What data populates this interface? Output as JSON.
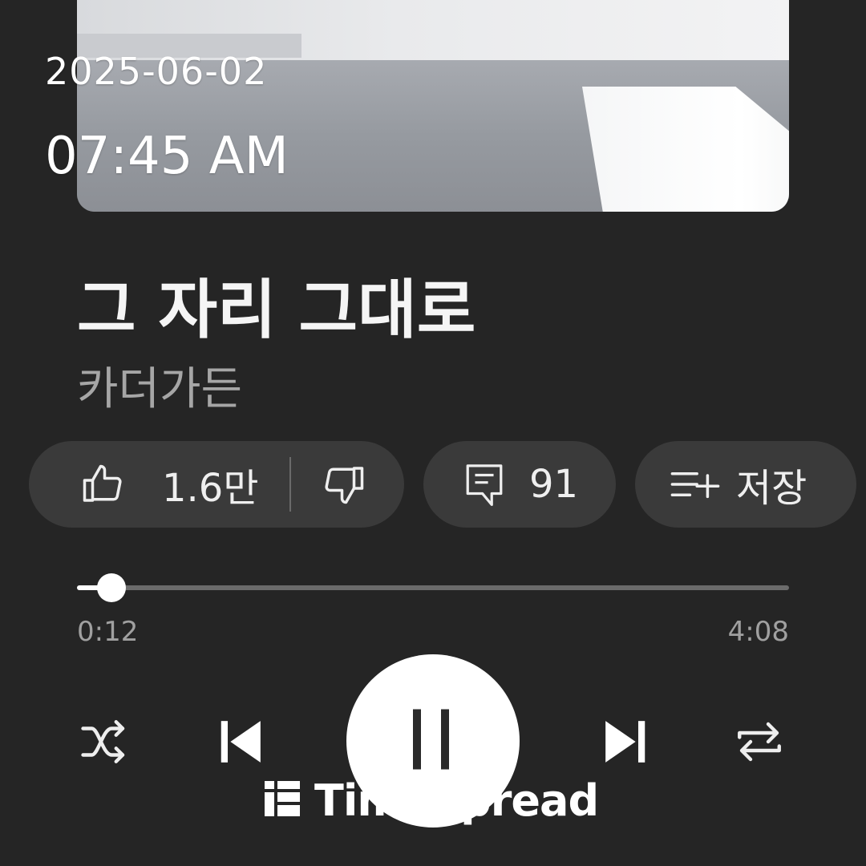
{
  "overlay": {
    "date": "2025-06-02",
    "time": "07:45 AM"
  },
  "track": {
    "title": "그 자리 그대로",
    "artist": "카더가든"
  },
  "actions": {
    "like_count": "1.6만",
    "comment_count": "91",
    "save_label": "저장"
  },
  "icons": {
    "like": "thumbs-up-icon",
    "dislike": "thumbs-down-icon",
    "comment": "comment-icon",
    "save": "playlist-add-icon",
    "shuffle": "shuffle-icon",
    "previous": "skip-previous-icon",
    "pause": "pause-icon",
    "next": "skip-next-icon",
    "repeat": "repeat-icon"
  },
  "player": {
    "elapsed": "0:12",
    "total": "4:08",
    "progress_fraction": 0.048
  },
  "watermark": {
    "text": "TimeSpread"
  },
  "colors": {
    "background": "#252525",
    "pill": "#3a3a3a",
    "track": "#6b6b6b",
    "accent": "#ffffff"
  }
}
